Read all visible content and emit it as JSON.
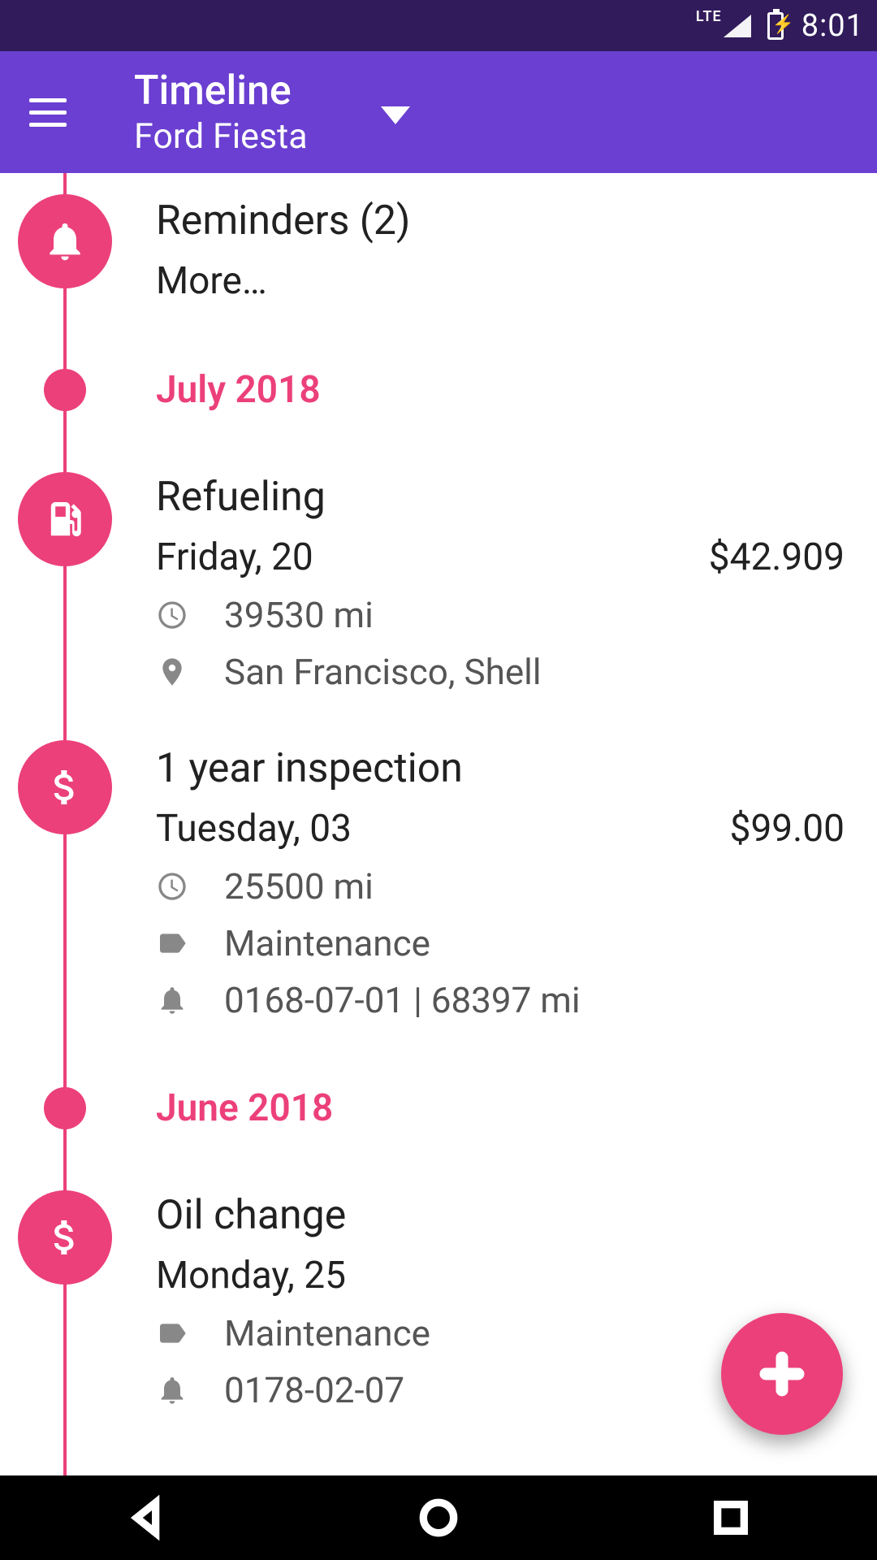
{
  "status": {
    "time": "8:01"
  },
  "appbar": {
    "title": "Timeline",
    "subtitle": "Ford Fiesta"
  },
  "reminders": {
    "title": "Reminders (2)",
    "more": "More…"
  },
  "months": {
    "july": "July 2018",
    "june": "June 2018"
  },
  "refueling": {
    "title": "Refueling",
    "date": "Friday, 20",
    "price": "$42.909",
    "odometer": "39530 mi",
    "location": "San Francisco, Shell"
  },
  "inspection": {
    "title": "1 year inspection",
    "date": "Tuesday, 03",
    "price": "$99.00",
    "odometer": "25500 mi",
    "category": "Maintenance",
    "reminder": "0168-07-01 | 68397 mi"
  },
  "oilchange": {
    "title": "Oil change",
    "date": "Monday, 25",
    "category": "Maintenance",
    "reminder": "0178-02-07"
  }
}
